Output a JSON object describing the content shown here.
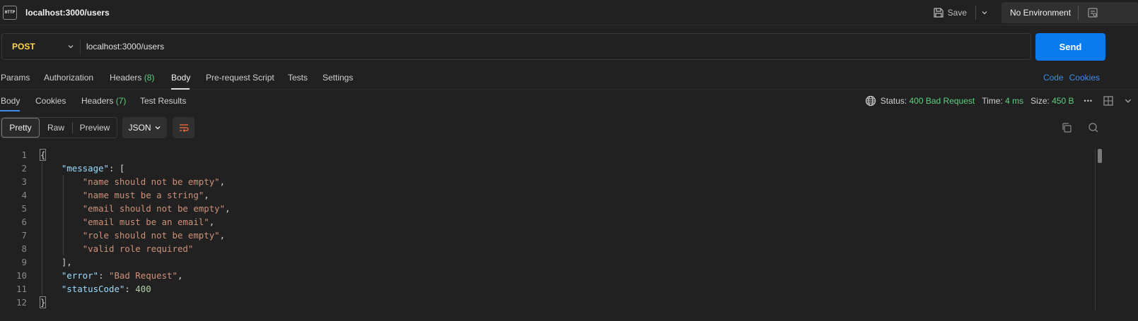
{
  "tab": {
    "title": "localhost:3000/users",
    "icon": "http-file-icon"
  },
  "toolbar": {
    "save_label": "Save",
    "environment": "No Environment"
  },
  "request": {
    "method": "POST",
    "url": "localhost:3000/users",
    "send_label": "Send"
  },
  "request_tabs": [
    {
      "label": "Params"
    },
    {
      "label": "Authorization"
    },
    {
      "label": "Headers",
      "count": "(8)"
    },
    {
      "label": "Body"
    },
    {
      "label": "Pre-request Script"
    },
    {
      "label": "Tests"
    },
    {
      "label": "Settings"
    }
  ],
  "request_tabs_active": "Body",
  "links": {
    "code": "Code",
    "cookies": "Cookies"
  },
  "response_tabs": [
    {
      "label": "Body"
    },
    {
      "label": "Cookies"
    },
    {
      "label": "Headers",
      "count": "(7)"
    },
    {
      "label": "Test Results"
    }
  ],
  "response_tabs_active": "Body",
  "status": {
    "status_label": "Status:",
    "status_value": "400 Bad Request",
    "time_label": "Time:",
    "time_value": "4 ms",
    "size_label": "Size:",
    "size_value": "450 B",
    "more": "•••"
  },
  "view": {
    "pretty": "Pretty",
    "raw": "Raw",
    "preview": "Preview",
    "format": "JSON",
    "active": "Pretty"
  },
  "code_lines": [
    {
      "n": "1",
      "parts": [
        [
          "p",
          "{"
        ]
      ]
    },
    {
      "n": "2",
      "parts": [
        [
          "p",
          "    "
        ],
        [
          "k",
          "\"message\""
        ],
        [
          "p",
          ": ["
        ]
      ]
    },
    {
      "n": "3",
      "parts": [
        [
          "p",
          "        "
        ],
        [
          "s",
          "\"name should not be empty\""
        ],
        [
          "p",
          ","
        ]
      ]
    },
    {
      "n": "4",
      "parts": [
        [
          "p",
          "        "
        ],
        [
          "s",
          "\"name must be a string\""
        ],
        [
          "p",
          ","
        ]
      ]
    },
    {
      "n": "5",
      "parts": [
        [
          "p",
          "        "
        ],
        [
          "s",
          "\"email should not be empty\""
        ],
        [
          "p",
          ","
        ]
      ]
    },
    {
      "n": "6",
      "parts": [
        [
          "p",
          "        "
        ],
        [
          "s",
          "\"email must be an email\""
        ],
        [
          "p",
          ","
        ]
      ]
    },
    {
      "n": "7",
      "parts": [
        [
          "p",
          "        "
        ],
        [
          "s",
          "\"role should not be empty\""
        ],
        [
          "p",
          ","
        ]
      ]
    },
    {
      "n": "8",
      "parts": [
        [
          "p",
          "        "
        ],
        [
          "s",
          "\"valid role required\""
        ]
      ]
    },
    {
      "n": "9",
      "parts": [
        [
          "p",
          "    ],"
        ]
      ]
    },
    {
      "n": "10",
      "parts": [
        [
          "p",
          "    "
        ],
        [
          "k",
          "\"error\""
        ],
        [
          "p",
          ": "
        ],
        [
          "s",
          "\"Bad Request\""
        ],
        [
          "p",
          ","
        ]
      ]
    },
    {
      "n": "11",
      "parts": [
        [
          "p",
          "    "
        ],
        [
          "k",
          "\"statusCode\""
        ],
        [
          "p",
          ": "
        ],
        [
          "n",
          "400"
        ]
      ]
    },
    {
      "n": "12",
      "parts": [
        [
          "p",
          "}"
        ]
      ]
    }
  ],
  "colors": {
    "accent": "#097bed",
    "method": "#ffd54f",
    "success_green": "#5fcf80",
    "link": "#3f8eea"
  }
}
